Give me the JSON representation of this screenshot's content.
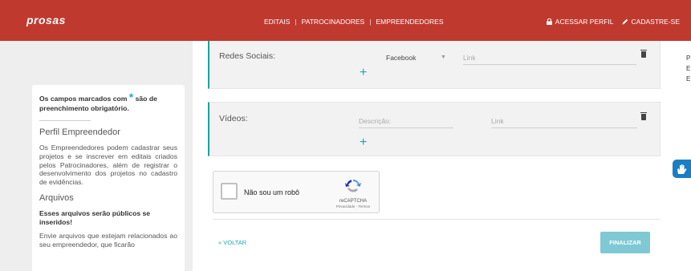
{
  "header": {
    "logo": "prosas",
    "nav": [
      "EDITAIS",
      "PATROCINADORES",
      "EMPREENDEDORES"
    ],
    "nav_separator": "|",
    "login_label": "ACESSAR PERFIL",
    "signup_label": "CADASTRE-SE",
    "bg_color": "#c0392f"
  },
  "sidebar": {
    "required_note": "Os campos marcados com",
    "required_star": "*",
    "required_note_end": "são de preenchimento obrigatório.",
    "profile_title": "Perfil Empreendedor",
    "profile_text": "Os Empreendedores podem cadastrar seus projetos e se inscrever em editais criados pelos Patrocinadores, além de registrar o desenvolvimento dos projetos no cadastro de evidências.",
    "files_title": "Arquivos",
    "files_subtitle": "Esses arquivos serão públicos se inseridos!",
    "files_text": "Envie arquivos que estejam relacionados ao seu empreendedor, que ficarão"
  },
  "social": {
    "title": "Redes Sociais:",
    "network_value": "Facebook",
    "link_placeholder": "Link"
  },
  "videos": {
    "title": "Vídeos:",
    "description_placeholder": "Descrição:",
    "link_placeholder": "Link"
  },
  "captcha": {
    "label": "Não sou um robô",
    "brand": "reCAPTCHA",
    "terms": "Privacidade - Termos"
  },
  "footer": {
    "back_label": "« VOLTAR",
    "finish_label": "FINALIZAR",
    "accent_color": "#19a7b0"
  },
  "right_panel": {
    "letters": [
      "P",
      "E",
      "E"
    ]
  }
}
